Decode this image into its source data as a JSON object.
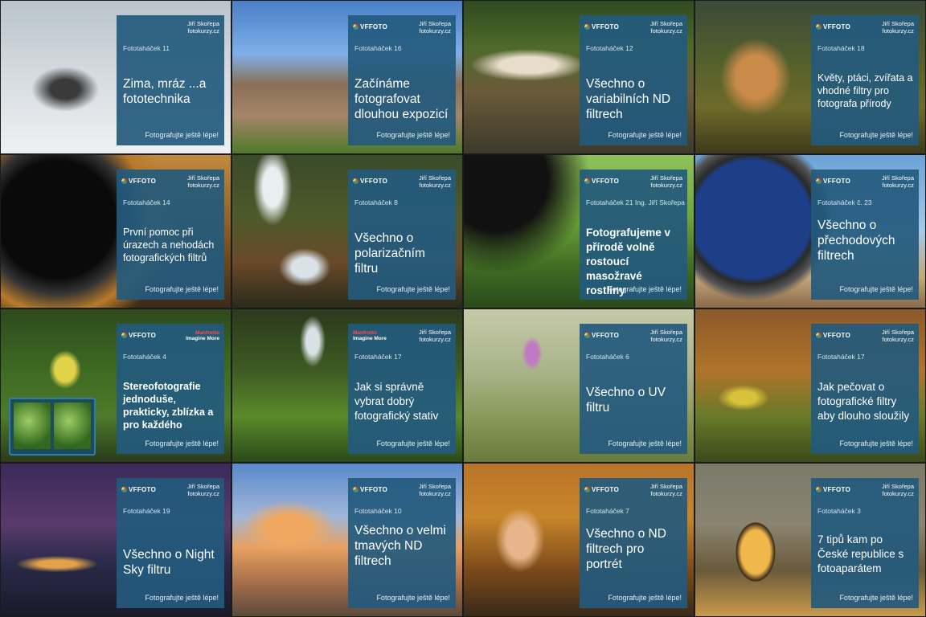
{
  "tagline": "Fotografujte ještě lépe!",
  "logos": {
    "vf": "VFFOTO",
    "js_name": "Jiří Skořepa",
    "js_site": "fotokurzy.cz",
    "mf_brand": "Manfrotto",
    "mf_sub": "Imagine More"
  },
  "tiles": [
    {
      "issue": "Fototaháček 11",
      "title": "Zima, mráz ...a fototechnika"
    },
    {
      "issue": "Fototaháček 16",
      "title": "Začínáme fotografovat dlouhou expozicí"
    },
    {
      "issue": "Fototaháček 12",
      "title": "Všechno o variabilních ND filtrech"
    },
    {
      "issue": "Fototaháček 18",
      "title": "Květy, ptáci, zvířata a vhodné filtry pro fotografa přírody"
    },
    {
      "issue": "Fototaháček 14",
      "title": "První pomoc při úrazech a nehodách fotografických filtrů"
    },
    {
      "issue": "Fototaháček 8",
      "title": "Všechno o polarizačním filtru"
    },
    {
      "issue": "Fototaháček 21   Ing. Jiří Skořepa",
      "title": "Fotografujeme v přírodě volně rostoucí masožravé rostliny"
    },
    {
      "issue": "Fototaháček č. 23",
      "title": "Všechno o přechodových filtrech"
    },
    {
      "issue": "Fototaháček 4",
      "title": "Stereofotografie jednoduše, prakticky, zblízka a pro každého"
    },
    {
      "issue": "Fototaháček 17",
      "title": "Jak si správně vybrat dobrý fotografický stativ"
    },
    {
      "issue": "Fototaháček 6",
      "title": "Všechno o UV filtru"
    },
    {
      "issue": "Fototaháček 17",
      "title": "Jak pečovat o fotografické filtry aby dlouho sloužily"
    },
    {
      "issue": "Fototaháček 19",
      "title": "Všechno o Night Sky filtru"
    },
    {
      "issue": "Fototaháček 10",
      "title": "Všechno o velmi tmavých ND filtrech"
    },
    {
      "issue": "Fototaháček 7",
      "title": "Všechno o ND filtrech pro portrét"
    },
    {
      "issue": "Fototaháček 3",
      "title": "7 tipů kam po České republice s fotoaparátem"
    }
  ]
}
